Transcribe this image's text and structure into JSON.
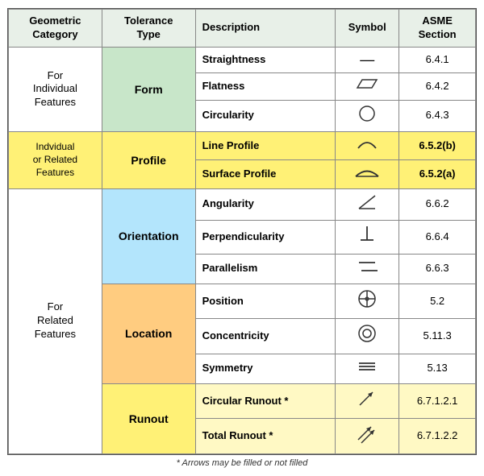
{
  "header": {
    "col1": "Geometric\nCategory",
    "col2": "Tolerance\nType",
    "col3": "Description",
    "col4": "Symbol",
    "col5": "ASME\nSection"
  },
  "groups": [
    {
      "geo_label": "For\nIndividual\nFeatures",
      "geo_rowspan": 4,
      "tol_label": "Form",
      "tol_rowspan": 3,
      "tol_bg": "green",
      "rows": [
        {
          "desc": "Straightness",
          "symbol": "—",
          "asme": "6.4.1",
          "row_bg": "white"
        },
        {
          "desc": "Flatness",
          "symbol": "▱",
          "asme": "6.4.2",
          "row_bg": "white"
        },
        {
          "desc": "Circularity",
          "symbol": "○",
          "asme": "6.4.3",
          "row_bg": "white"
        }
      ]
    }
  ],
  "footer_note": "* Arrows may be filled or not filled",
  "rows": [
    {
      "geo": "For\nIndividual\nFeatures",
      "geo_rowspan": 4,
      "geo_bg": "white",
      "tol": "Form",
      "tol_rowspan": 3,
      "tol_bg": "green",
      "desc": "Straightness",
      "symbol": "line",
      "asme": "6.4.1",
      "row_bg": "white"
    },
    {
      "geo": null,
      "tol": null,
      "desc": "Flatness",
      "symbol": "parallelogram",
      "asme": "6.4.2",
      "row_bg": "white"
    },
    {
      "geo": null,
      "tol": null,
      "desc": "Circularity",
      "symbol": "circle",
      "asme": "6.4.3",
      "row_bg": "white"
    },
    {
      "geo": "Indvidual\nor Related\nFeatures",
      "geo_rowspan": 2,
      "geo_bg": "yellow",
      "tol": "Profile",
      "tol_rowspan": 2,
      "tol_bg": "yellow",
      "desc": "Line Profile",
      "symbol": "arc_open",
      "asme": "6.5.2(b)",
      "row_bg": "yellow"
    },
    {
      "geo": null,
      "tol": null,
      "desc": "Surface Profile",
      "symbol": "arc_flat",
      "asme": "6.5.2(a)",
      "row_bg": "yellow"
    },
    {
      "geo": "For\nRelated\nFeatures",
      "geo_rowspan": 8,
      "geo_bg": "white",
      "tol": "Orientation",
      "tol_rowspan": 3,
      "tol_bg": "blue",
      "desc": "Angularity",
      "symbol": "angle",
      "asme": "6.6.2",
      "row_bg": "white"
    },
    {
      "geo": null,
      "tol": null,
      "desc": "Perpendicularity",
      "symbol": "perp",
      "asme": "6.6.4",
      "row_bg": "white"
    },
    {
      "geo": null,
      "tol": null,
      "desc": "Parallelism",
      "symbol": "parallel",
      "asme": "6.6.3",
      "row_bg": "white"
    },
    {
      "geo": null,
      "tol": "Location",
      "tol_rowspan": 3,
      "tol_bg": "orange",
      "desc": "Position",
      "symbol": "position",
      "asme": "5.2",
      "row_bg": "white"
    },
    {
      "geo": null,
      "tol": null,
      "desc": "Concentricity",
      "symbol": "concentricity",
      "asme": "5.11.3",
      "row_bg": "white"
    },
    {
      "geo": null,
      "tol": null,
      "desc": "Symmetry",
      "symbol": "symmetry",
      "asme": "5.13",
      "row_bg": "white"
    },
    {
      "geo": null,
      "tol": "Runout",
      "tol_rowspan": 2,
      "tol_bg": "yellow_light",
      "desc": "Circular Runout *",
      "symbol": "runout1",
      "asme": "6.7.1.2.1",
      "row_bg": "yellow_light"
    },
    {
      "geo": null,
      "tol": null,
      "desc": "Total Runout *",
      "symbol": "runout2",
      "asme": "6.7.1.2.2",
      "row_bg": "yellow_light"
    }
  ]
}
